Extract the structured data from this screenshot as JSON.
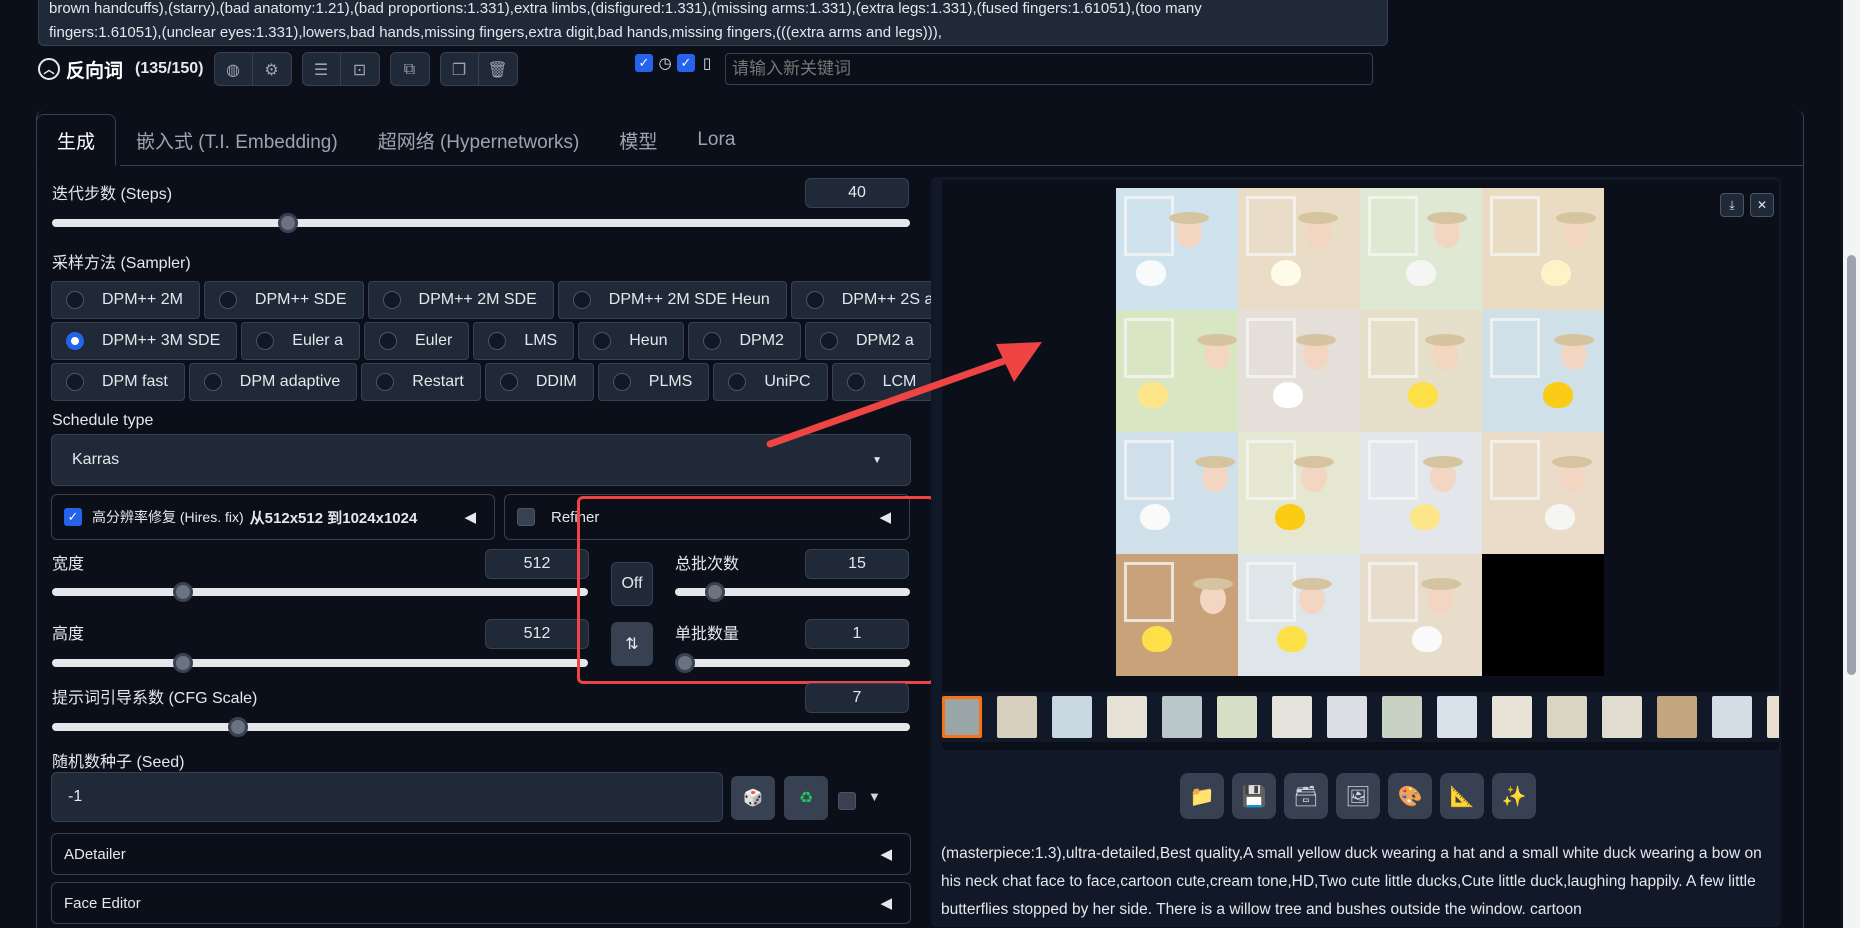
{
  "prompt_text": {
    "line1": "brown handcuffs),(starry),(bad anatomy:1.21),(bad proportions:1.331),extra limbs,(disfigured:1.331),(missing arms:1.331),(extra legs:1.331),(fused fingers:1.61051),(too many",
    "line2": "fingers:1.61051),(unclear eyes:1.331),lowers,bad hands,missing fingers,extra digit,bad hands,missing fingers,(((extra arms and legs))),"
  },
  "negative": {
    "title": "反向词",
    "count": "(135/150)",
    "keyword_placeholder": "请输入新关键词"
  },
  "tabs": [
    "生成",
    "嵌入式 (T.I. Embedding)",
    "超网络 (Hypernetworks)",
    "模型",
    "Lora"
  ],
  "steps": {
    "label": "迭代步数 (Steps)",
    "value": "40",
    "fraction": 0.27
  },
  "sampler": {
    "label": "采样方法 (Sampler)",
    "row1": [
      "DPM++ 2M",
      "DPM++ SDE",
      "DPM++ 2M SDE",
      "DPM++ 2M SDE Heun",
      "DPM++ 2S a"
    ],
    "row2": [
      "DPM++ 3M SDE",
      "Euler a",
      "Euler",
      "LMS",
      "Heun",
      "DPM2",
      "DPM2 a"
    ],
    "row3": [
      "DPM fast",
      "DPM adaptive",
      "Restart",
      "DDIM",
      "PLMS",
      "UniPC",
      "LCM"
    ],
    "selected": "DPM++ 3M SDE"
  },
  "schedule": {
    "label": "Schedule type",
    "value": "Karras"
  },
  "hires": {
    "label": "高分辨率修复 (Hires. fix)",
    "detail": "从512x512 到1024x1024"
  },
  "refiner": {
    "label": "Refiner"
  },
  "width": {
    "label": "宽度",
    "value": "512",
    "fraction": 0.235
  },
  "height": {
    "label": "高度",
    "value": "512",
    "fraction": 0.235
  },
  "batch_count": {
    "label": "总批次数",
    "value": "15",
    "fraction": 0.14
  },
  "batch_size": {
    "label": "单批数量",
    "value": "1",
    "fraction": 0.0
  },
  "swap_off": "Off",
  "cfg": {
    "label": "提示词引导系数 (CFG Scale)",
    "value": "7",
    "fraction": 0.21
  },
  "seed": {
    "label": "随机数种子 (Seed)",
    "value": "-1"
  },
  "adetailer": "ADetailer",
  "face_editor": "Face Editor",
  "caption": "(masterpiece:1.3),ultra-detailed,Best quality,A small yellow duck wearing a hat and a small white duck wearing a bow on his neck chat face to face,cartoon cute,cream tone,HD,Two cute little ducks,Cute little duck,laughing happily. A few little butterflies stopped by her side. There is a willow tree and bushes outside the window. cartoon",
  "colors": {
    "accent": "#2563eb",
    "annotation": "#ef4444",
    "selected_thumb": "#f97316"
  }
}
